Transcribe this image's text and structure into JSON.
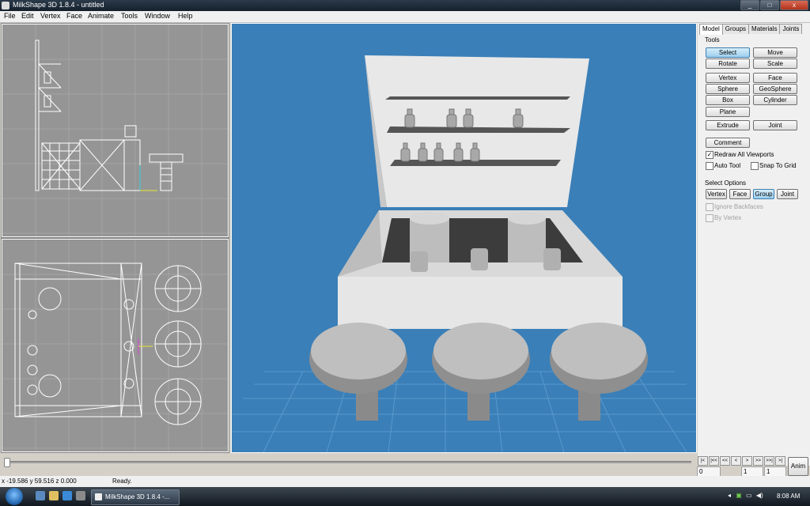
{
  "window": {
    "title": "MilkShape 3D 1.8.4 - untitled",
    "min": "_",
    "max": "□",
    "close": "x"
  },
  "menu": [
    "File",
    "Edit",
    "Vertex",
    "Face",
    "Animate",
    "Tools",
    "Window",
    "Help"
  ],
  "panel": {
    "tabs": [
      "Model",
      "Groups",
      "Materials",
      "Joints"
    ],
    "tools_header": "Tools",
    "tool_buttons": [
      "Select",
      "Move",
      "Rotate",
      "Scale",
      "Vertex",
      "Face",
      "Sphere",
      "GeoSphere",
      "Box",
      "Cylinder",
      "Plane",
      "Extrude",
      "Joint",
      "Comment"
    ],
    "active_tool": "Select",
    "checkboxes": [
      {
        "label": "Redraw All Viewports",
        "checked": true
      },
      {
        "label": "Auto Tool",
        "checked": false
      },
      {
        "label": "Snap To Grid",
        "checked": false
      }
    ],
    "select_options_header": "Select Options",
    "select_buttons": [
      "Vertex",
      "Face",
      "Group",
      "Joint"
    ],
    "active_select": "Group",
    "disabled_options": [
      "Ignore Backfaces",
      "By Vertex"
    ]
  },
  "animation": {
    "nav_buttons": [
      "|<",
      "|<<",
      "<<",
      "<",
      ">",
      ">>",
      ">>|",
      ">|"
    ],
    "frame_fields": [
      "0",
      "1",
      "1"
    ],
    "anim_button": "Anim"
  },
  "status": {
    "coords": "x -19.586 y 59.516 z 0.000",
    "message": "Ready."
  },
  "taskbar": {
    "task": "MilkShape 3D 1.8.4 -...",
    "clock": "8:08 AM"
  },
  "colors": {
    "viewport_bg": "#959595",
    "perspective_bg": "#3a7fb8",
    "button_active": "#9ccfef"
  },
  "icons": [
    "milkshape-icon",
    "windows-start-icon",
    "show-desktop-icon",
    "explorer-icon",
    "ie-icon",
    "volume-icon",
    "network-icon"
  ]
}
